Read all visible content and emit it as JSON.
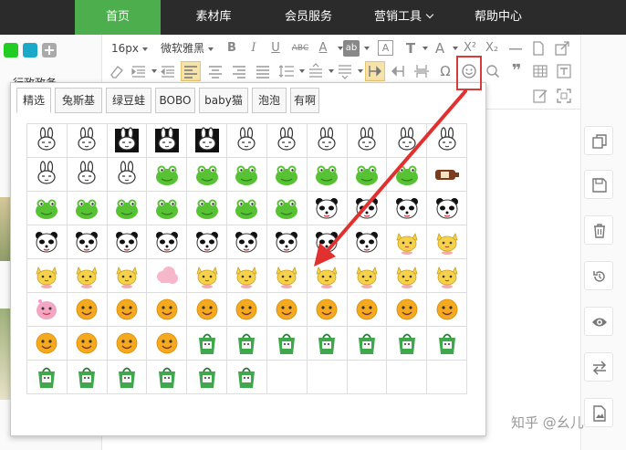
{
  "nav": [
    {
      "label": "首页",
      "active": true,
      "dropdown": false
    },
    {
      "label": "素材库",
      "active": false,
      "dropdown": false
    },
    {
      "label": "会员服务",
      "active": false,
      "dropdown": false
    },
    {
      "label": "营销工具",
      "active": false,
      "dropdown": true
    },
    {
      "label": "帮助中心",
      "active": false,
      "dropdown": false
    }
  ],
  "left_panel": {
    "label": "行政政务",
    "swatch_colors": [
      "#22cc22",
      "#1aa9c9",
      "#aaaaaa"
    ]
  },
  "toolbar": {
    "font_size": "16px",
    "font_family": "微软雅黑",
    "bold": "B",
    "italic": "I",
    "underline": "U",
    "strike": "ABC",
    "font_color": "A",
    "bg_color": "ab",
    "border_text": "A",
    "text_style": "T",
    "text_shadow": "A",
    "superscript": "X²",
    "subscript": "X₂",
    "omega": "Ω",
    "quote": "❞"
  },
  "popup": {
    "tabs": [
      "精选",
      "兔斯基",
      "绿豆蛙",
      "BOBO",
      "baby猫",
      "泡泡",
      "有啊"
    ],
    "active_tab": 0
  },
  "emoticon_grid": {
    "rows": [
      [
        "tusiji",
        "tusiji",
        "tusiji-bw",
        "tusiji-bw",
        "tusiji-bw",
        "tusiji",
        "tusiji",
        "tusiji",
        "tusiji",
        "tusiji",
        "tusiji"
      ],
      [
        "tusiji",
        "tusiji",
        "tusiji",
        "frog",
        "frog",
        "frog",
        "frog",
        "frog",
        "frog",
        "frog",
        "bottle"
      ],
      [
        "frog",
        "frog",
        "frog",
        "frog",
        "frog",
        "frog",
        "frog",
        "panda",
        "panda",
        "panda",
        "panda"
      ],
      [
        "panda",
        "panda",
        "panda",
        "panda",
        "panda",
        "panda",
        "panda",
        "panda",
        "panda",
        "cat",
        "cat"
      ],
      [
        "cat",
        "cat",
        "cat",
        "cloud",
        "cat",
        "cat",
        "cat",
        "cat",
        "cat",
        "cat",
        "cat"
      ],
      [
        "bubble",
        "smiley",
        "smiley",
        "smiley",
        "smiley",
        "smiley",
        "smiley",
        "smiley",
        "smiley",
        "smiley",
        "smiley"
      ],
      [
        "smiley",
        "smiley",
        "smiley",
        "smiley",
        "bag",
        "bag",
        "bag",
        "bag",
        "bag",
        "bag",
        "bag"
      ],
      [
        "bag",
        "bag",
        "bag",
        "bag",
        "bag",
        "bag",
        "",
        "",
        "",
        "",
        ""
      ]
    ],
    "colors": {
      "tusiji": "#ffffff",
      "tusiji-bw": "#111111",
      "frog": "#57c233",
      "bottle": "#7a3b1f",
      "panda": "#222222",
      "cat": "#f5d24a",
      "cloud": "#f6b8c8",
      "bubble": "#f2a6c4",
      "smiley": "#f5a91e",
      "bag": "#3fa84d"
    }
  },
  "watermark": "知乎 @幺儿",
  "accent_color": "#4cae4c",
  "arrow_color": "#e13030"
}
